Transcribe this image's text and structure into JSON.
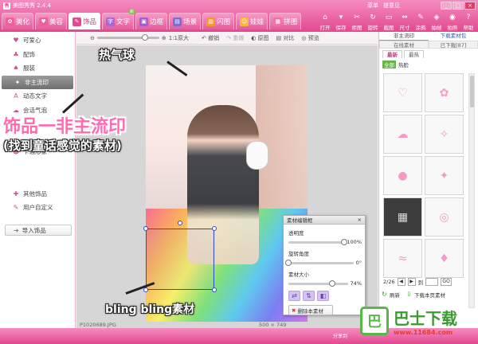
{
  "app": {
    "title": "美图秀秀 2.4.4",
    "logo_glyph": "秀",
    "menu": [
      "菜单",
      "提意见"
    ],
    "window_controls": [
      "_",
      "□",
      "×"
    ]
  },
  "tabs": [
    {
      "label": "美化",
      "icon": "palette-icon",
      "glyph": "✿",
      "color": "#f25d9c",
      "active": false
    },
    {
      "label": "美容",
      "icon": "cosmetics-icon",
      "glyph": "♥",
      "color": "#f25d9c",
      "active": false
    },
    {
      "label": "饰品",
      "icon": "ornament-icon",
      "glyph": "✎",
      "color": "#e2498f",
      "active": true
    },
    {
      "label": "文字",
      "icon": "text-icon",
      "glyph": "字",
      "color": "#a669d6",
      "active": false,
      "badge": "新"
    },
    {
      "label": "边框",
      "icon": "frame-icon",
      "glyph": "▣",
      "color": "#a55cd0",
      "active": false
    },
    {
      "label": "场景",
      "icon": "scene-icon",
      "glyph": "▤",
      "color": "#7b6ad6",
      "active": false
    },
    {
      "label": "闪图",
      "icon": "flash-icon",
      "glyph": "▥",
      "color": "#f09a35",
      "active": false
    },
    {
      "label": "娃娃",
      "icon": "doll-icon",
      "glyph": "☺",
      "color": "#f3b742",
      "active": false
    },
    {
      "label": "拼图",
      "icon": "collage-icon",
      "glyph": "▦",
      "color": "#f072a6",
      "active": false
    }
  ],
  "toolbar_buttons": [
    {
      "label": "打开",
      "icon": "folder-icon",
      "glyph": "⌂"
    },
    {
      "label": "保存",
      "icon": "save-icon",
      "glyph": "▾"
    },
    {
      "label": "拒图",
      "icon": "crop-icon",
      "glyph": "✂"
    },
    {
      "label": "旋转",
      "icon": "rotate-icon",
      "glyph": "↻"
    },
    {
      "label": "截图",
      "icon": "screenshot-icon",
      "glyph": "▭"
    },
    {
      "label": "尺寸",
      "icon": "resize-icon",
      "glyph": "⇔"
    },
    {
      "label": "涂鸦",
      "icon": "doodle-icon",
      "glyph": "✎"
    },
    {
      "label": "抽帧",
      "icon": "frames-icon",
      "glyph": "◈"
    },
    {
      "label": "拍照",
      "icon": "camera-icon",
      "glyph": "◉"
    },
    {
      "label": "帮助",
      "icon": "help-icon",
      "glyph": "?"
    }
  ],
  "sidebar": {
    "items": [
      {
        "label": "可爱心",
        "icon": "heart-icon",
        "glyph": "♥",
        "active": false
      },
      {
        "label": "配饰",
        "icon": "accessory-icon",
        "glyph": "♣",
        "active": false
      },
      {
        "label": "服装",
        "icon": "clothing-icon",
        "glyph": "♠",
        "active": false
      },
      {
        "label": "非主流印",
        "icon": "stamp-icon",
        "glyph": "✦",
        "active": true
      },
      {
        "label": "动态文字",
        "icon": "motion-text-icon",
        "glyph": "A",
        "active": false
      },
      {
        "label": "会话气泡",
        "icon": "speech-bubble-icon",
        "glyph": "☁",
        "active": false
      },
      {
        "label": "",
        "icon": "blank-icon",
        "glyph": "",
        "active": false
      },
      {
        "label": "",
        "icon": "blank-icon",
        "glyph": "",
        "active": false
      },
      {
        "label": "卡通形象",
        "icon": "cartoon-icon",
        "glyph": "☻",
        "active": false
      },
      {
        "label": "",
        "icon": "blank-icon",
        "glyph": "",
        "active": false
      },
      {
        "label": "",
        "icon": "blank-icon",
        "glyph": "",
        "active": false
      },
      {
        "label": "其他饰品",
        "icon": "misc-ornament-icon",
        "glyph": "✚",
        "active": false
      },
      {
        "label": "用户自定义",
        "icon": "custom-icon",
        "glyph": "✎",
        "active": false
      }
    ],
    "import_label": "导入饰品"
  },
  "canvas_toolbar": {
    "zoom_label": "1:1原大",
    "buttons": [
      "撤销",
      "重做",
      "原图",
      "对比",
      "预览"
    ]
  },
  "annotations": {
    "balloon": "热气球",
    "title": "饰品一非主流印",
    "subtitle": "(找到童话感觉的素材)",
    "bling": "bling bling素材"
  },
  "photo": {
    "filename": "P1020689.JPG",
    "dimensions": "500 × 749"
  },
  "material_editor": {
    "title": "素材编辑框",
    "opacity_label": "透明度",
    "opacity_value": "100%",
    "opacity": 1.0,
    "rotation_label": "旋转角度",
    "rotation_value": "0°",
    "rotation": 0.0,
    "size_label": "素材大小",
    "size_value": "74%",
    "size": 0.74,
    "delete_label": "删除本素材"
  },
  "right_panel": {
    "tab_active": "非主流印",
    "tab_link": "下载素材包",
    "sub_tabs": [
      "在线素材",
      "已下载[87]"
    ],
    "filter_tabs": [
      "最新",
      "最热"
    ],
    "category_all": "全部",
    "category_hot": "热脸",
    "page": "2/26",
    "goto_label": "到",
    "go_label": "GO",
    "refresh_label": "刷新",
    "download_page_label": "下载本页素材"
  },
  "status_bar": {
    "share": "分享到"
  },
  "watermark": {
    "glyph": "巴",
    "name": "巴士下载",
    "url": "www.11684.com"
  }
}
